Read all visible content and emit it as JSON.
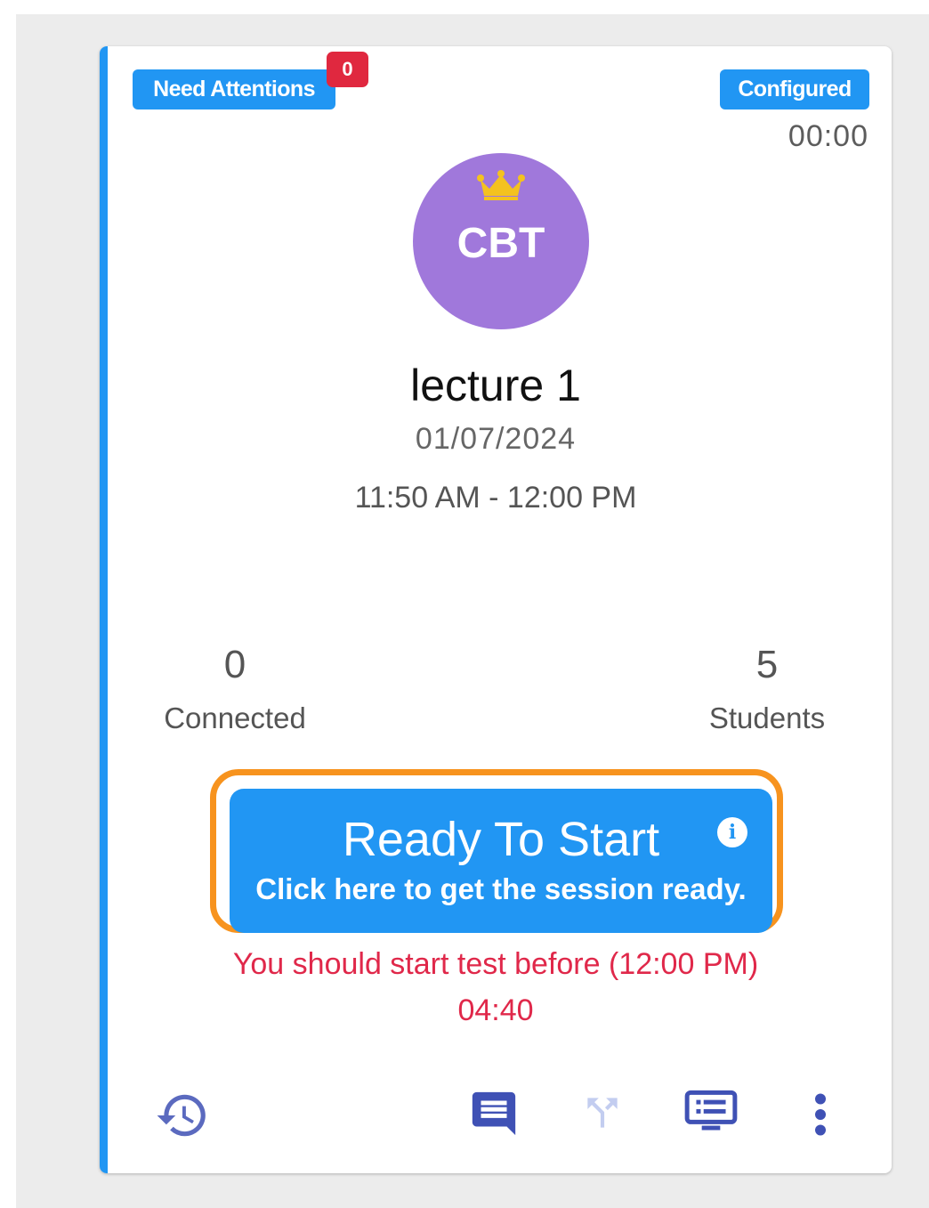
{
  "card": {
    "accent_color": "#2196f3",
    "need_attention": {
      "label": "Need Attentions",
      "count": "0"
    },
    "status": {
      "label": "Configured",
      "timer": "00:00"
    },
    "avatar": {
      "text": "CBT",
      "color": "#a078db",
      "icon": "crown-icon"
    },
    "title": "lecture 1",
    "date": "01/07/2024",
    "time_range": "11:50 AM - 12:00 PM",
    "stats": {
      "connected": {
        "value": "0",
        "label": "Connected"
      },
      "students": {
        "value": "5",
        "label": "Students"
      }
    },
    "action": {
      "title": "Ready To Start",
      "subtitle": "Click here to get the session ready.",
      "info_icon": "info-icon"
    },
    "warning": {
      "message": "You should start test before (12:00 PM)",
      "countdown": "04:40"
    },
    "toolbar": {
      "icons": [
        "history-icon",
        "chat-icon",
        "fork-icon",
        "message-screen-icon",
        "more-vert-icon"
      ]
    }
  }
}
